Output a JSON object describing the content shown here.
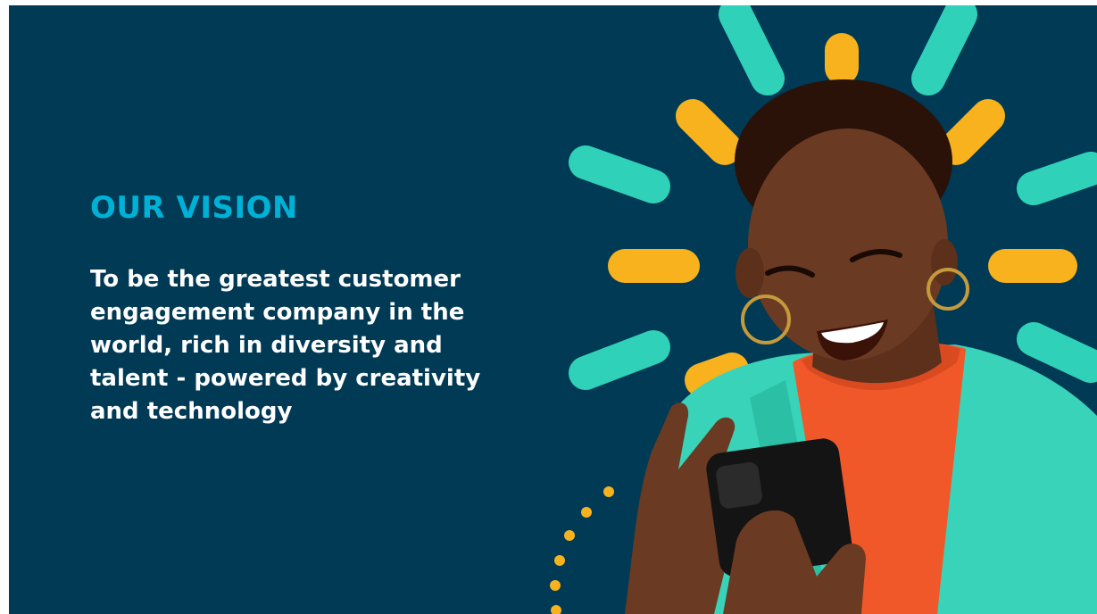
{
  "vision": {
    "heading": "OUR VISION",
    "statement": "To be the greatest customer engagement company in the world, rich in diversity and talent - powered by creativity and technology"
  },
  "colors": {
    "background": "#003a55",
    "heading": "#00b1d6",
    "text": "#ffffff",
    "ray_teal": "#2fd2b9",
    "ray_yellow": "#f7b21e",
    "jacket": "#39d3b9",
    "top": "#f0582a",
    "skin": "#6b3a22",
    "phone": "#141414"
  },
  "illustration": {
    "subject": "smiling-woman-with-phone",
    "decoration": "sunburst-rays"
  }
}
